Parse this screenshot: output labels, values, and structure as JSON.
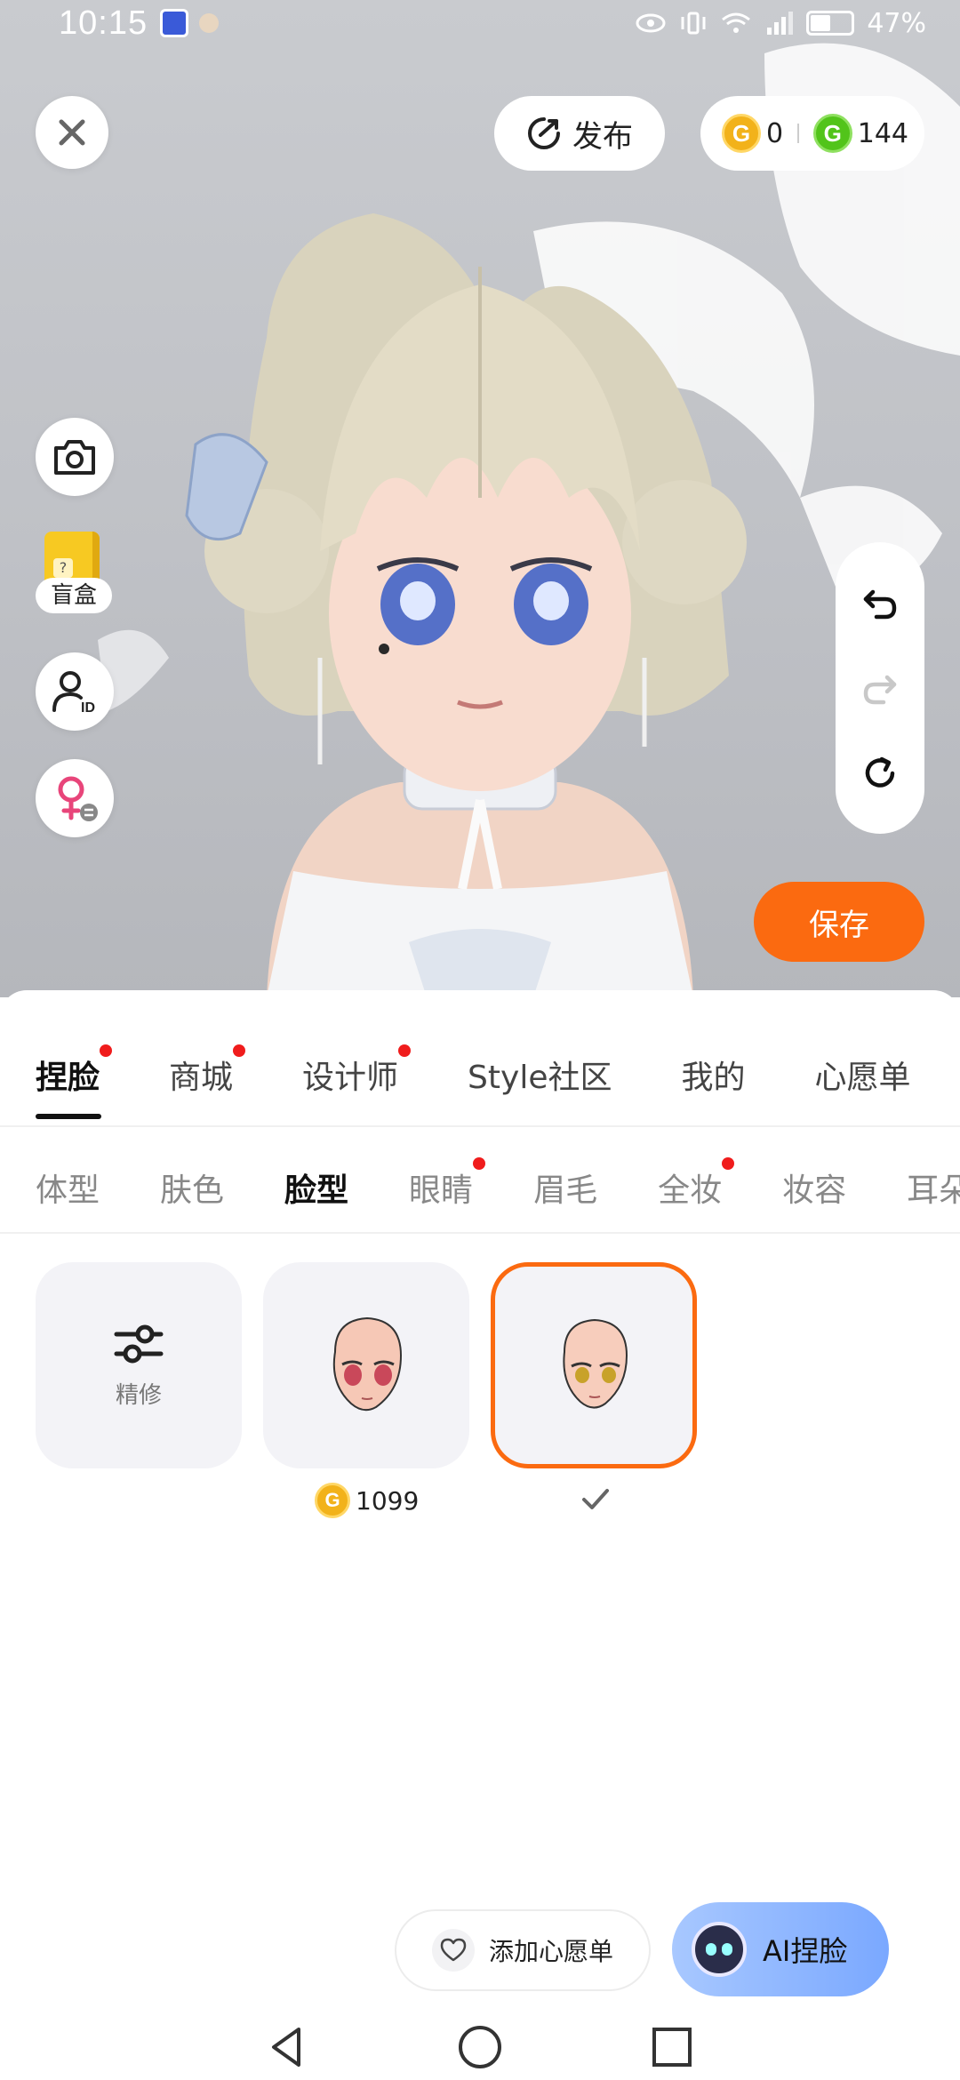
{
  "status_bar": {
    "time": "10:15",
    "battery": "47%"
  },
  "top_bar": {
    "publish_label": "发布",
    "gold_coin_count": "0",
    "green_coin_count": "144",
    "coin_glyph": "G"
  },
  "side_tools": {
    "blind_box_label": "盲盒",
    "id_badge": "ID"
  },
  "save_label": "保存",
  "main_tabs": [
    {
      "label": "捏脸",
      "active": true,
      "dot": true
    },
    {
      "label": "商城",
      "active": false,
      "dot": true
    },
    {
      "label": "设计师",
      "active": false,
      "dot": true
    },
    {
      "label": "Style社区",
      "active": false,
      "dot": false
    },
    {
      "label": "我的",
      "active": false,
      "dot": false
    },
    {
      "label": "心愿单",
      "active": false,
      "dot": false
    }
  ],
  "sub_tabs": [
    {
      "label": "体型",
      "active": false,
      "dot": false
    },
    {
      "label": "肤色",
      "active": false,
      "dot": false
    },
    {
      "label": "脸型",
      "active": true,
      "dot": false
    },
    {
      "label": "眼睛",
      "active": false,
      "dot": true
    },
    {
      "label": "眉毛",
      "active": false,
      "dot": false
    },
    {
      "label": "全妆",
      "active": false,
      "dot": true
    },
    {
      "label": "妆容",
      "active": false,
      "dot": false
    },
    {
      "label": "耳朵",
      "active": false,
      "dot": false
    }
  ],
  "items": {
    "refine_label": "精修",
    "face_1_price": "1099",
    "selected_check": "✓"
  },
  "bottom": {
    "wishlist_label": "添加心愿单",
    "ai_face_label": "AI捏脸"
  },
  "colors": {
    "accent": "#fb6a10",
    "notify_dot": "#f01c1c",
    "gold_coin": "#f2b21a",
    "green_coin": "#52c41a"
  }
}
